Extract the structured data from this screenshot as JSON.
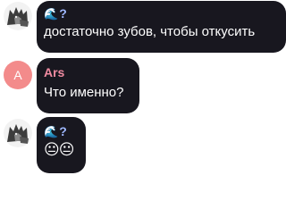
{
  "messages": [
    {
      "sender_emoji": "🌊",
      "sender_suffix": "?",
      "text": "достаточно зубов, чтобы откусить"
    },
    {
      "avatar_letter": "A",
      "sender": "Ars",
      "text": "Что именно?"
    },
    {
      "sender_emoji": "🌊",
      "sender_suffix": "?",
      "text": "😐😐"
    }
  ],
  "colors": {
    "bubble": "#18171f",
    "ars_name": "#f08ba1",
    "avatar_ars": "#f38b8b",
    "wave_name": "#9fb8ff"
  }
}
